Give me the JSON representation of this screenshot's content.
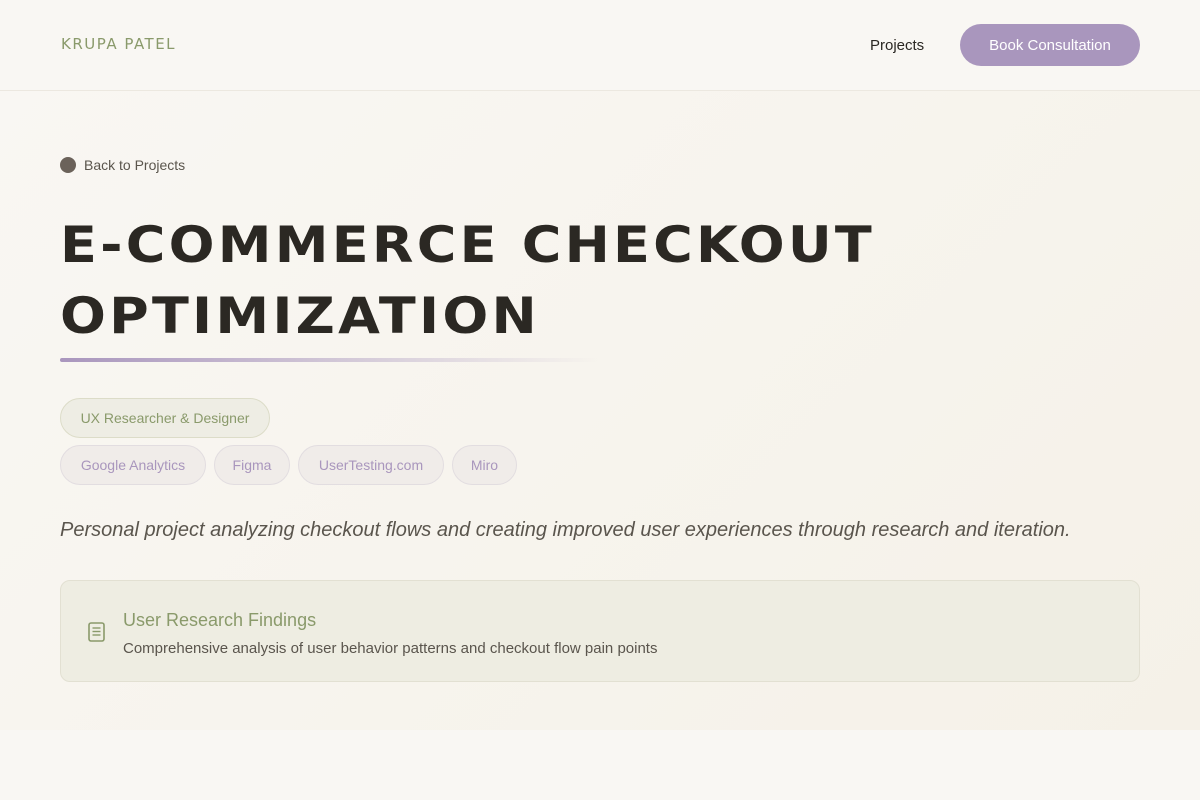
{
  "header": {
    "logo": "KRUPA PATEL",
    "nav_projects": "Projects",
    "cta": "Book Consultation"
  },
  "hero": {
    "back_link": "Back to Projects",
    "title_line1": "E-COMMERCE CHECKOUT",
    "title_line2": "OPTIMIZATION",
    "role_chip": "UX Researcher & Designer",
    "tools": [
      "Google Analytics",
      "Figma",
      "UserTesting.com",
      "Miro"
    ],
    "tagline": "Personal project analyzing checkout flows and creating improved user experiences through research and iteration."
  },
  "card": {
    "icon": "document-icon",
    "title": "User Research Findings",
    "description": "Comprehensive analysis of user behavior patterns and checkout flow pain points"
  },
  "colors": {
    "accent_purple": "#a996bd",
    "accent_green": "#8a9a6b",
    "background": "#f9f7f3",
    "text_dark": "#2b2823"
  }
}
